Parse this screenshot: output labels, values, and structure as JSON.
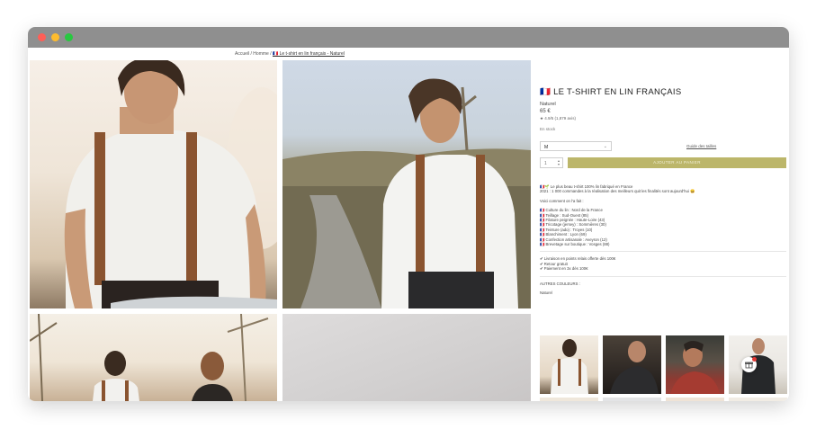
{
  "browser": {
    "dots": [
      "close",
      "minimize",
      "maximize"
    ]
  },
  "breadcrumb": {
    "home": "Accueil",
    "sep1": "/",
    "category": "Homme",
    "sep2": "/",
    "current": "🇫🇷 Le t-shirt en lin français - Naturel"
  },
  "product": {
    "title": "🇫🇷 LE T-SHIRT EN LIN FRANÇAIS",
    "color": "Naturel",
    "price": "65 €",
    "rating": "★ 4.9/5 (1,879 avis)",
    "stock": "En stock",
    "size_selected": "M",
    "size_guide": "Guide des tailles",
    "qty": "1",
    "add_to_cart": "AJOUTER AU PANIER"
  },
  "description": {
    "lines": [
      "🇫🇷🌱 Le plus beau t-shirt 100% lin fabriqué en France",
      "2021 : 1 000 commandes à la réalisation des meilleurs quit les finalités sont aujourd'hui 😄",
      "",
      "Voici comment on l'a fait :",
      "",
      "🇫🇷 Culture du lin : Nord de la France",
      "🇫🇷 Teillage : Sud-Ouest (85)",
      "🇫🇷 Filature peignée : Haute-Loire (43)",
      "🇫🇷 Tricotage (jersey) : Sommières (30)",
      "🇫🇷 Teinture (ado) : Troyes (10)",
      "🇫🇷 Blanchiment : Lyon (69)",
      "🇫🇷 Confection artisanale : Aveyron (12)",
      "🇫🇷 Brevetage sur boutique : Vosges (88)",
      "",
      "✔ Livraison en points relais offerte dès 100€",
      "✔ Retour gratuit",
      "✔ Paiement en 3x dès 100€"
    ]
  },
  "other_colors": {
    "heading": "AUTRES COULEURS :",
    "current": "Naturel"
  },
  "widgets": {
    "gift_icon": "gift-icon"
  }
}
